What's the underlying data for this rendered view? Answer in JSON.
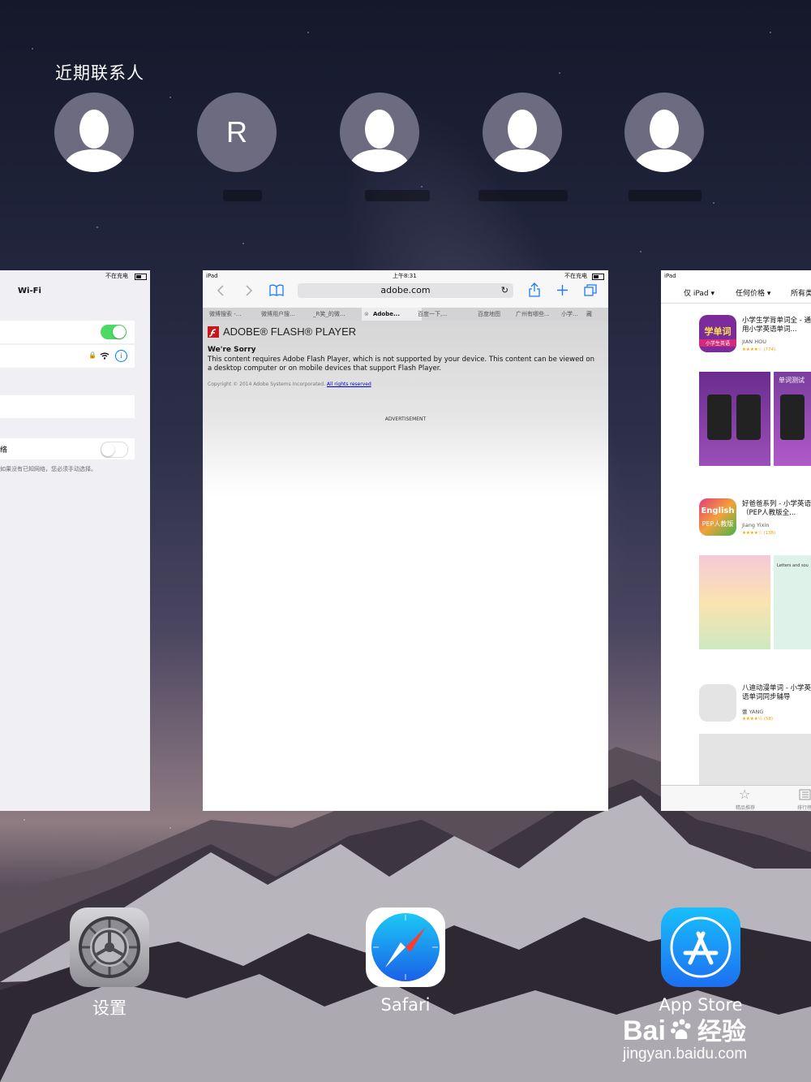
{
  "recent_contacts": {
    "title": "近期联系人",
    "contacts": [
      {
        "type": "silhouette"
      },
      {
        "type": "initial",
        "initial": "R"
      },
      {
        "type": "silhouette"
      },
      {
        "type": "silhouette"
      },
      {
        "type": "silhouette"
      }
    ]
  },
  "settings_card": {
    "status_charging": "不在充电",
    "title": "Wi-Fi",
    "note": "如果没有已知网络，您必须手动选择。",
    "wifi_toggle_on": true,
    "ask_toggle_on": false,
    "accent_color": "#4cd964"
  },
  "safari_card": {
    "status_device": "iPad",
    "status_time": "上午8:31",
    "status_charging": "不在充电",
    "url": "adobe.com",
    "tabs": [
      "微博搜索 -...",
      "微博用户搜...",
      "_R笑_的微...",
      "Adobe...",
      "百度一下,...",
      "百度地图",
      "广州有哪些...",
      "小学..."
    ],
    "tab_overflow": "藏",
    "active_tab_index": 3,
    "flash_title": "ADOBE® FLASH® PLAYER",
    "sorry_heading": "We're Sorry",
    "sorry_body": "This content requires Adobe Flash Player, which is not supported by your device. This content can be viewed on a desktop computer or on mobile devices that support Flash Player.",
    "copyright": "Copyright © 2014 Adobe Systems Incorporated.",
    "rights_link": "All rights reserved",
    "advertisement": "ADVERTISEMENT"
  },
  "appstore_card": {
    "status_device": "iPad",
    "filter_device": "仅 iPad ▾",
    "filter_price": "任何价格 ▾",
    "filter_all": "所有类",
    "items": [
      {
        "title": "小学生学背单词全 - 通用小学英语单词...",
        "developer": "JIAN HOU",
        "rating": "★★★★☆ (774)",
        "icon_text": "学单词",
        "icon_sub": "小学生英语"
      },
      {
        "title": "好爸爸系列 - 小学英语（PEP人教版全...",
        "developer": "Jiang Yixin",
        "rating": "★★★★☆ (138)",
        "icon_text": "English",
        "icon_sub": "PEP人教版"
      },
      {
        "title": "八迪动漫单词 - 小学英语单词同步辅导",
        "developer": "蕾 YANG",
        "rating": "★★★★½ (58)"
      }
    ],
    "screenshot_label_1": "单词测试",
    "screenshot_label_2": "Letters and sou",
    "tab_featured": "精品推荐",
    "tab_charts": "排行榜"
  },
  "dock": {
    "apps": [
      {
        "label": "设置",
        "icon": "settings-gear-icon"
      },
      {
        "label": "Safari",
        "icon": "safari-compass-icon"
      },
      {
        "label": "App Store",
        "icon": "app-store-a-icon"
      }
    ]
  },
  "watermark": {
    "brand": "Bai",
    "brand_cn": "经验",
    "url": "jingyan.baidu.com"
  }
}
